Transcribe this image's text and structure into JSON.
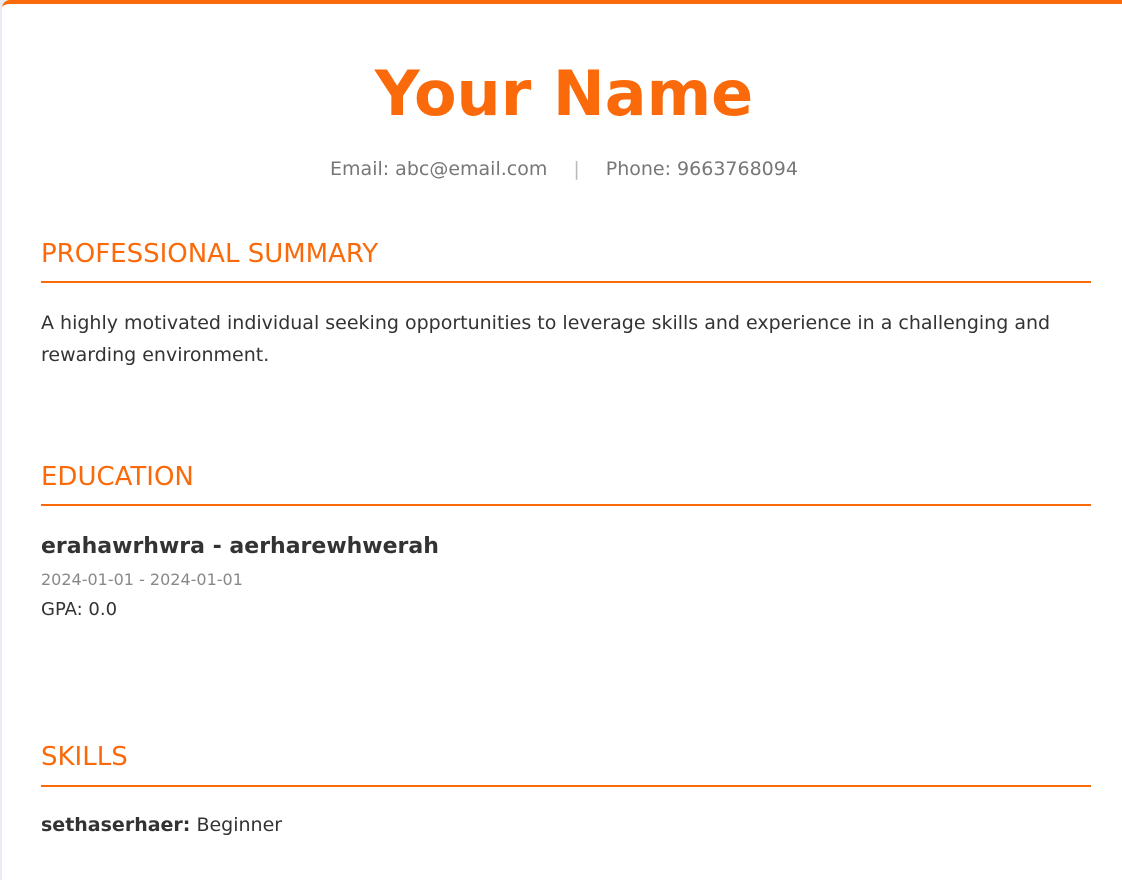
{
  "header": {
    "name": "Your Name",
    "email": "Email: abc@email.com",
    "separator": "|",
    "phone": "Phone: 9663768094"
  },
  "summary": {
    "title": "PROFESSIONAL SUMMARY",
    "text": "A highly motivated individual seeking opportunities to leverage skills and experience in a challenging and rewarding environment."
  },
  "education": {
    "title": "EDUCATION",
    "items": [
      {
        "degree": "erahawrhwra - aerharewhwerah",
        "dates": "2024-01-01 - 2024-01-01",
        "gpa": "GPA: 0.0"
      }
    ]
  },
  "skills": {
    "title": "SKILLS",
    "items": [
      {
        "name": "sethaserhaer:",
        "level": "Beginner"
      }
    ]
  },
  "colors": {
    "accent": "#fb6a0a",
    "text": "#333333",
    "muted": "#888888"
  }
}
